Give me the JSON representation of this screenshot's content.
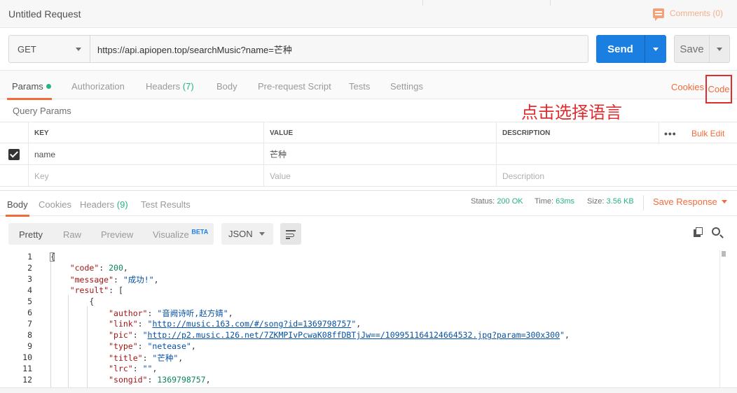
{
  "titlebar": {
    "title": "Untitled Request",
    "comments_label": "Comments (0)"
  },
  "request": {
    "method": "GET",
    "url": "https://api.apiopen.top/searchMusic?name=芒种",
    "send_label": "Send",
    "save_label": "Save"
  },
  "request_tabs": {
    "params": "Params",
    "authorization": "Authorization",
    "headers": "Headers",
    "headers_count": "(7)",
    "body": "Body",
    "prerequest": "Pre-request Script",
    "tests": "Tests",
    "settings": "Settings",
    "cookies": "Cookies",
    "code": "Code"
  },
  "annotation": "点击选择语言",
  "query_params": {
    "title": "Query Params",
    "columns": [
      "KEY",
      "VALUE",
      "DESCRIPTION"
    ],
    "more": "•••",
    "bulk_edit": "Bulk Edit",
    "rows": [
      {
        "key": "name",
        "value": "芒种",
        "description": ""
      }
    ],
    "placeholders": {
      "key": "Key",
      "value": "Value",
      "description": "Description"
    }
  },
  "response_tabs": {
    "body": "Body",
    "cookies": "Cookies",
    "headers": "Headers",
    "headers_count": "(9)",
    "test_results": "Test Results",
    "status_label": "Status:",
    "status_value": "200 OK",
    "time_label": "Time:",
    "time_value": "63ms",
    "size_label": "Size:",
    "size_value": "3.56 KB",
    "save_response": "Save Response"
  },
  "viewer": {
    "pretty": "Pretty",
    "raw": "Raw",
    "preview": "Preview",
    "visualize": "Visualize",
    "beta": "BETA",
    "format": "JSON"
  },
  "code_lines": [
    {
      "n": "1",
      "html": "{"
    },
    {
      "n": "2",
      "html": "    <span class='k'>\"code\"</span>: <span class='n'>200</span>,"
    },
    {
      "n": "3",
      "html": "    <span class='k'>\"message\"</span>: <span class='s'>\"成功!\"</span>,"
    },
    {
      "n": "4",
      "html": "    <span class='k'>\"result\"</span>: ["
    },
    {
      "n": "5",
      "html": "        {"
    },
    {
      "n": "6",
      "html": "            <span class='k'>\"author\"</span>: <span class='s'>\"音阙诗听,赵方婧\"</span>,"
    },
    {
      "n": "7",
      "html": "            <span class='k'>\"link\"</span>: <span class='s'>\"<span class='u'>http://music.163.com/#/song?id=1369798757</span>\"</span>,"
    },
    {
      "n": "8",
      "html": "            <span class='k'>\"pic\"</span>: <span class='s'>\"<span class='u'>http://p2.music.126.net/7ZKMPIvPcwaK08ffDBTjJw==/109951164124664532.jpg?param=300x300</span>\"</span>,"
    },
    {
      "n": "9",
      "html": "            <span class='k'>\"type\"</span>: <span class='s'>\"netease\"</span>,"
    },
    {
      "n": "10",
      "html": "            <span class='k'>\"title\"</span>: <span class='s'>\"芒种\"</span>,"
    },
    {
      "n": "11",
      "html": "            <span class='k'>\"lrc\"</span>: <span class='s'>\"\"</span>,"
    },
    {
      "n": "12",
      "html": "            <span class='k'>\"songid\"</span>: <span class='n'>1369798757</span>,"
    }
  ]
}
